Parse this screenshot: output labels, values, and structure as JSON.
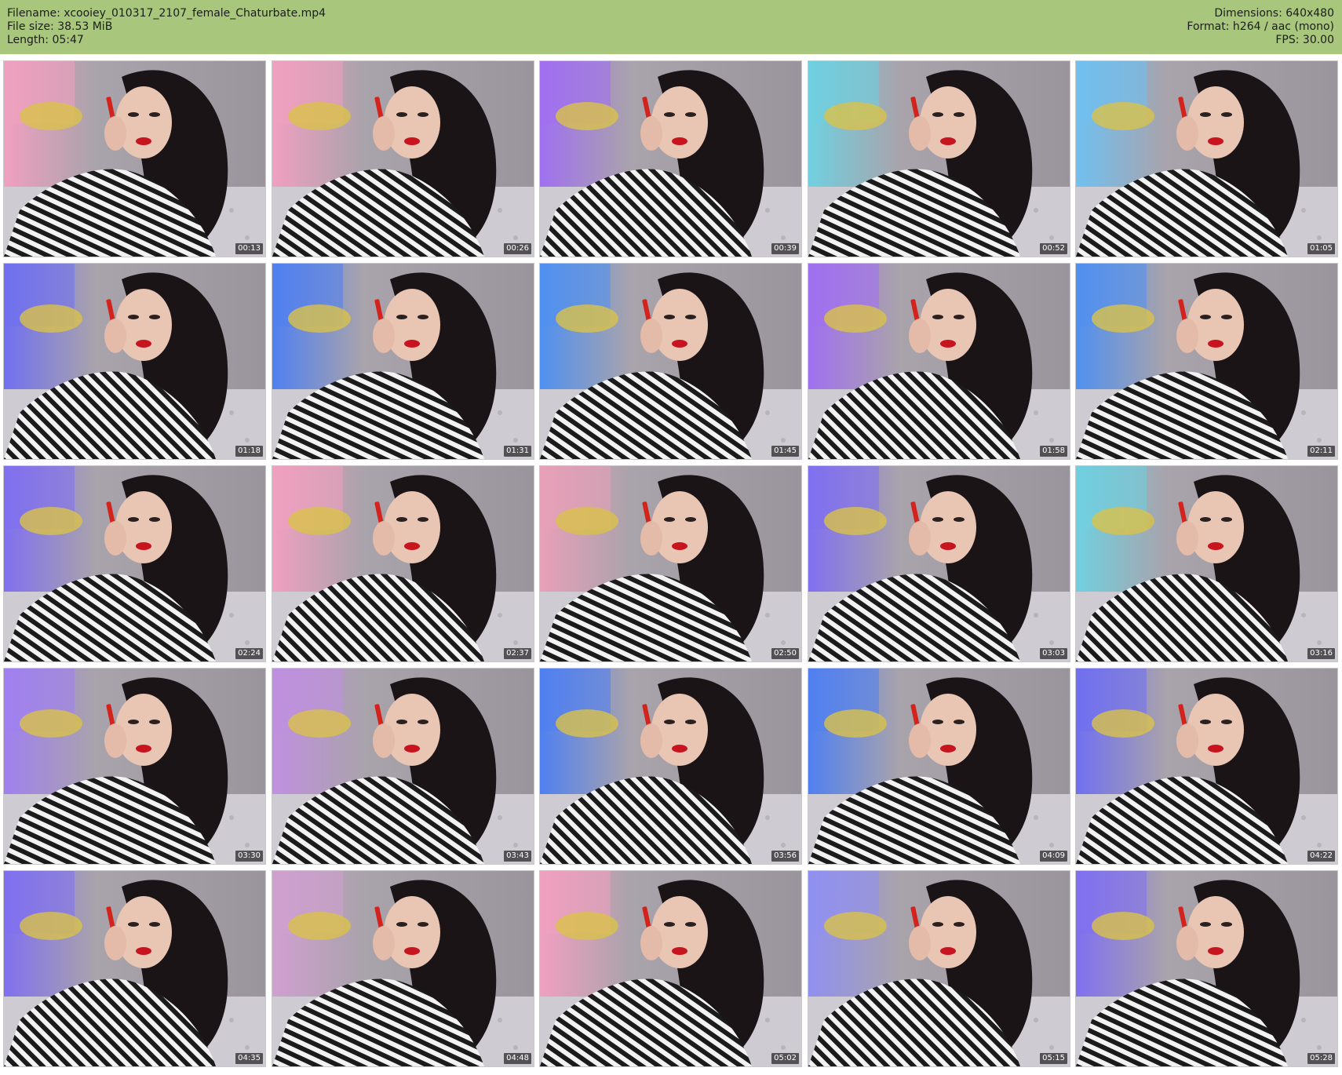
{
  "meta": {
    "filename": "Filename: xcooiey_010317_2107_female_Chaturbate.mp4",
    "filesize": "File size: 38.53 MiB",
    "length": "Length: 05:47",
    "dimensions": "Dimensions: 640x480",
    "format": "Format: h264 / aac (mono)",
    "fps": "FPS: 30.00"
  },
  "colors": {
    "header_bg": "#a9c77c",
    "page_bg": "#ffffff"
  },
  "thumbnails": [
    {
      "time": "00:13",
      "accent": "#f0a0c0"
    },
    {
      "time": "00:26",
      "accent": "#f0a0c0"
    },
    {
      "time": "00:39",
      "accent": "#a070f0"
    },
    {
      "time": "00:52",
      "accent": "#70d0e0"
    },
    {
      "time": "01:05",
      "accent": "#70c0f0"
    },
    {
      "time": "01:18",
      "accent": "#7070f0"
    },
    {
      "time": "01:31",
      "accent": "#5080f0"
    },
    {
      "time": "01:45",
      "accent": "#5090f0"
    },
    {
      "time": "01:58",
      "accent": "#a070f0"
    },
    {
      "time": "02:11",
      "accent": "#5090f0"
    },
    {
      "time": "02:24",
      "accent": "#8070f0"
    },
    {
      "time": "02:37",
      "accent": "#f0a0c0"
    },
    {
      "time": "02:50",
      "accent": "#e8a0b8"
    },
    {
      "time": "03:03",
      "accent": "#8070f0"
    },
    {
      "time": "03:16",
      "accent": "#70d0e0"
    },
    {
      "time": "03:30",
      "accent": "#a080f0"
    },
    {
      "time": "03:43",
      "accent": "#c090e0"
    },
    {
      "time": "03:56",
      "accent": "#5080f0"
    },
    {
      "time": "04:09",
      "accent": "#5080f0"
    },
    {
      "time": "04:22",
      "accent": "#7070f0"
    },
    {
      "time": "04:35",
      "accent": "#8070f0"
    },
    {
      "time": "04:48",
      "accent": "#d0a0d0"
    },
    {
      "time": "05:02",
      "accent": "#f0a0c0"
    },
    {
      "time": "05:15",
      "accent": "#9090f0"
    },
    {
      "time": "05:28",
      "accent": "#8070f0"
    }
  ]
}
